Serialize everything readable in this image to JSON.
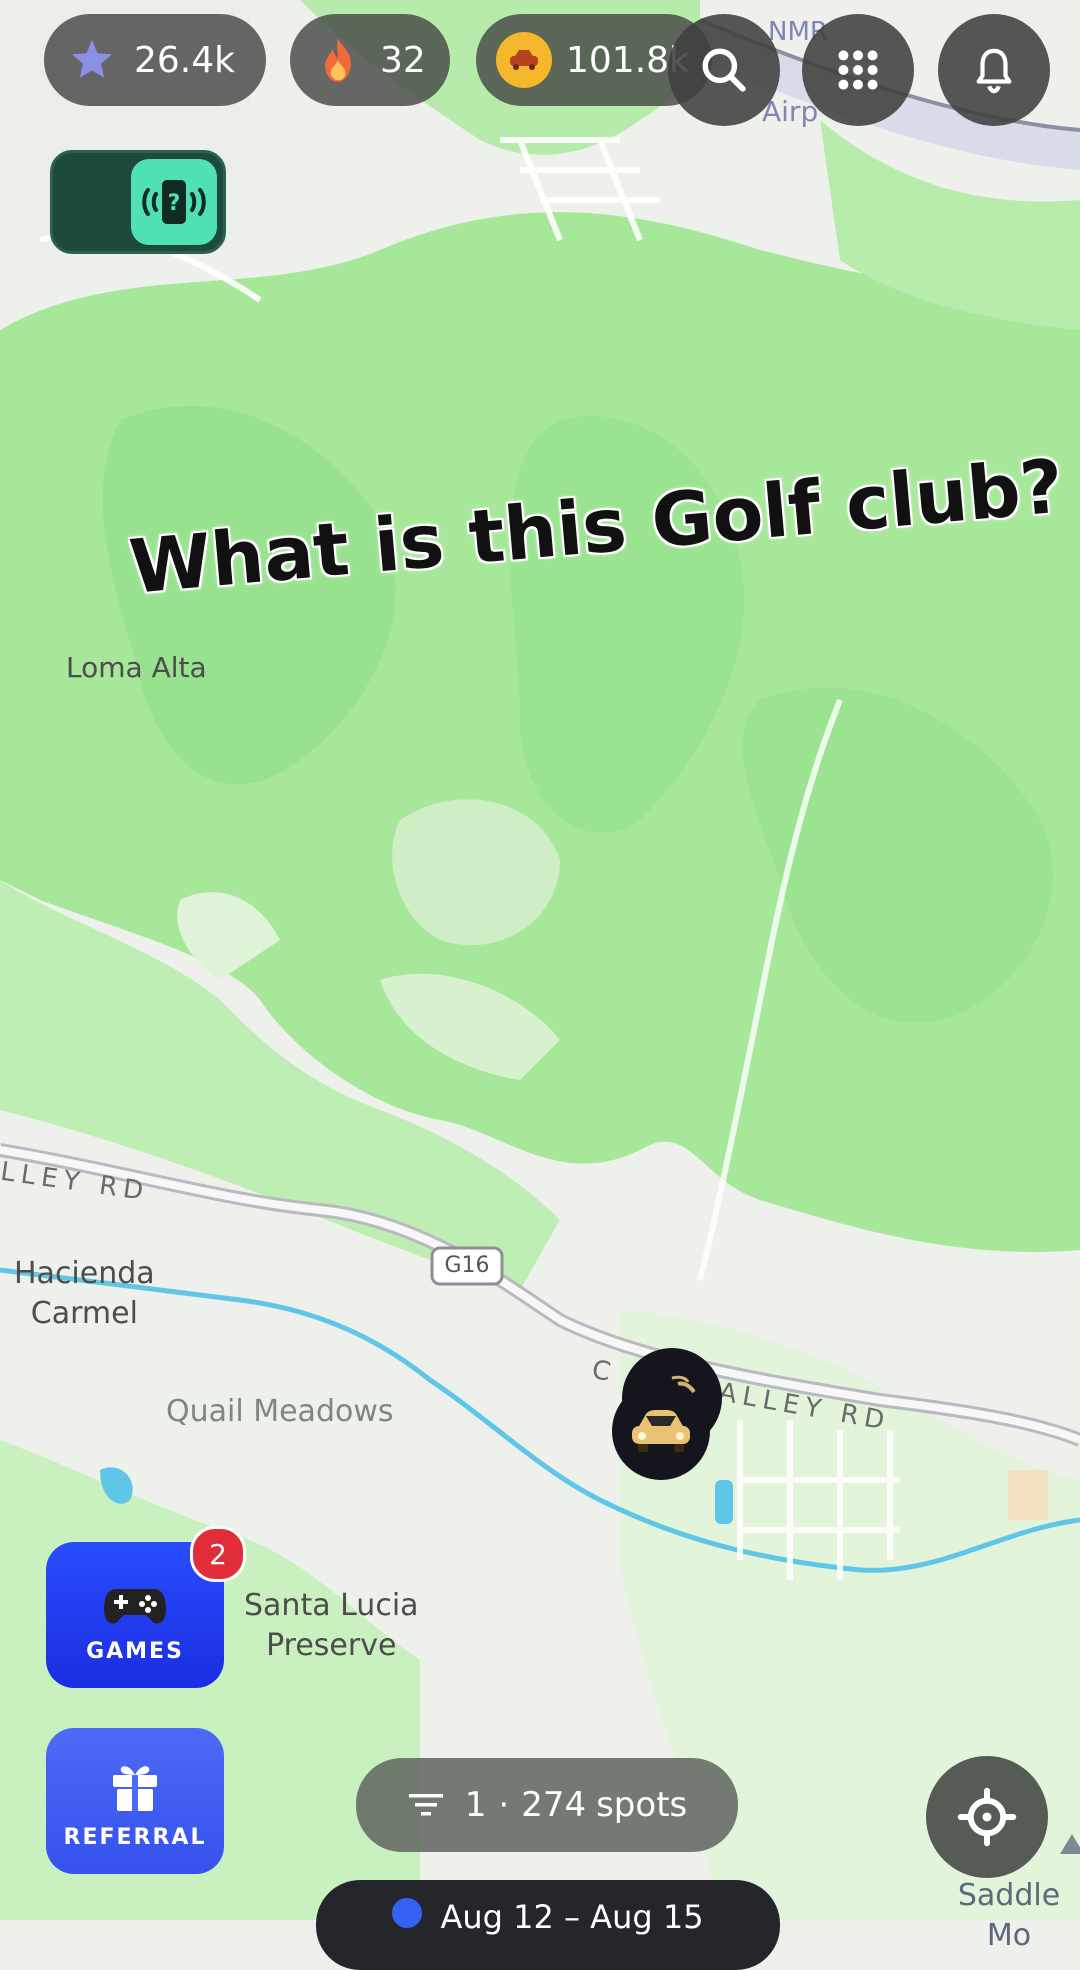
{
  "stats": {
    "stars": "26.4k",
    "streak": "32",
    "coins": "101.8k"
  },
  "overlay_text": "What is this Golf club?",
  "map_labels": {
    "airport": "Airp",
    "airport_short": "NMR",
    "loma_alta": "Loma Alta",
    "hacienda": "Hacienda\nCarmel",
    "quail": "Quail Meadows",
    "santa_lucia": "Santa Lucia\nPreserve",
    "saddle": "Saddle Mo",
    "valley_rd_left": "LLEY RD",
    "valley_rd_right": "C   N VALLEY RD",
    "route_shield": "G16"
  },
  "games": {
    "label": "GAMES",
    "badge": "2"
  },
  "referral": {
    "label": "REFERRAL"
  },
  "spots": {
    "count": "1",
    "separator": "·",
    "total": "274",
    "unit": "spots"
  },
  "date_range": "Aug 12 – Aug 15",
  "colors": {
    "map_green": "#a6e79a",
    "map_base": "#eef0ec",
    "water": "#5fc6e8",
    "accent_teal": "#4fe0b5",
    "games_blue": "#1f3cf0",
    "referral_blue": "#3b5bf0",
    "coin_gold": "#f5b72b"
  },
  "icons": [
    "star-icon",
    "fire-icon",
    "coin-icon",
    "search-icon",
    "grid-icon",
    "bell-icon",
    "nfc-question-icon",
    "gamepad-icon",
    "gift-icon",
    "filter-icon",
    "locate-icon",
    "car-marker-icon"
  ]
}
